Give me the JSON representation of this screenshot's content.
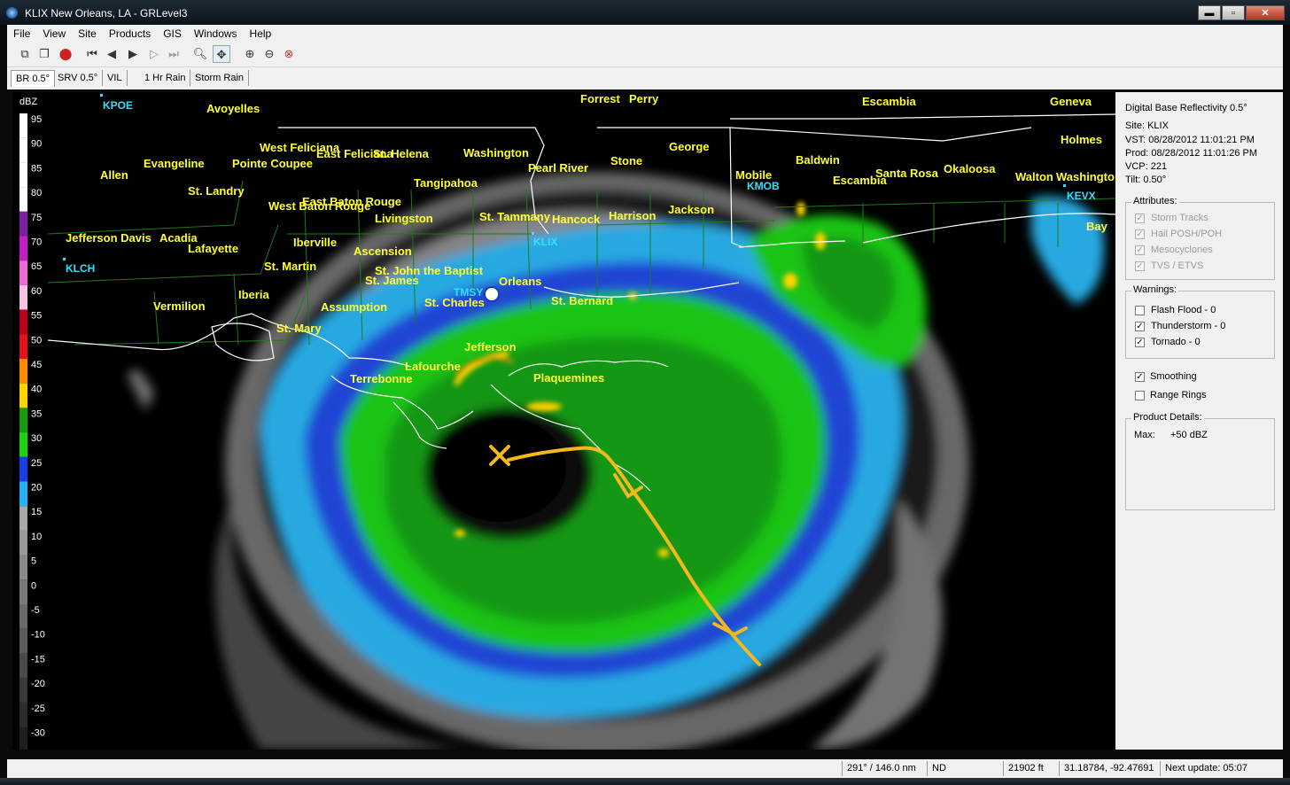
{
  "window": {
    "title": "KLIX New Orleans, LA - GRLevel3",
    "minimize_glyph": "▬",
    "maximize_glyph": "▫",
    "close_glyph": "✕"
  },
  "menu": [
    "File",
    "View",
    "Site",
    "Products",
    "GIS",
    "Windows",
    "Help"
  ],
  "toolbar_icons": [
    "copy-icon",
    "paste-icon",
    "record-icon",
    "first-frame-icon",
    "prev-frame-icon",
    "play-icon",
    "next-frame-icon",
    "last-frame-icon",
    "zoom-icon",
    "pan-icon",
    "zoom-in-icon",
    "zoom-out-icon",
    "zoom-reset-icon"
  ],
  "tabs": [
    "BR 0.5°",
    "SRV 0.5°",
    "VIL",
    "1 Hr Rain",
    "Storm Rain"
  ],
  "color_scale": {
    "unit": "dBZ",
    "ticks": [
      "95",
      "90",
      "85",
      "80",
      "75",
      "70",
      "65",
      "60",
      "55",
      "50",
      "45",
      "40",
      "35",
      "30",
      "25",
      "20",
      "15",
      "10",
      "5",
      "0",
      "-5",
      "-10",
      "-15",
      "-20",
      "-25",
      "-30"
    ],
    "colors": [
      "#ffffff",
      "#ffffff",
      "#ffffff",
      "#ffffff",
      "#7c1fa3",
      "#c21fc4",
      "#ef6ad5",
      "#f5c3e3",
      "#b8001b",
      "#e0141a",
      "#ff8c00",
      "#ffd200",
      "#159a12",
      "#1fd013",
      "#1a3ee8",
      "#26b0f5",
      "#a8a8a8",
      "#9a9a9a",
      "#8a8a8a",
      "#7a7a7a",
      "#6a6a6a",
      "#5a5a5a",
      "#4a4a4a",
      "#3a3a3a",
      "#2c2c2c",
      "#1e1e1e"
    ]
  },
  "stations": [
    "KPOE",
    "KLCH",
    "KLIX",
    "KMOB",
    "KEVX",
    "TMSY"
  ],
  "places": [
    "Avoyelles",
    "Forrest",
    "Perry",
    "Escambia",
    "Geneva",
    "West Feliciana",
    "East Feliciana",
    "St. Helena",
    "Washington",
    "George",
    "Holmes",
    "Evangeline",
    "Pointe Coupee",
    "Pearl River",
    "Stone",
    "Baldwin",
    "Allen",
    "St. Landry",
    "Tangipahoa",
    "Mobile",
    "Escambia",
    "Santa Rosa",
    "Okaloosa",
    "Walton",
    "Washington",
    "East Baton Rouge",
    "West Baton Rouge",
    "Livingston",
    "St. Tammany",
    "Hancock",
    "Harrison",
    "Jackson",
    "Jefferson Davis",
    "Acadia",
    "Lafayette",
    "Iberville",
    "Bay",
    "Ascension",
    "St. Martin",
    "St. John the Baptist",
    "St. James",
    "Orleans",
    "Iberia",
    "St. Charles",
    "St. Bernard",
    "Vermilion",
    "Assumption",
    "St. Mary",
    "Jefferson",
    "Lafourche",
    "Terrebonne",
    "Plaquemines"
  ],
  "product": {
    "name": "Digital Base Reflectivity 0.5°",
    "site": "Site:  KLIX",
    "vst": "VST:  08/28/2012  11:01:21 PM",
    "prod": "Prod: 08/28/2012  11:01:26 PM",
    "vcp": "VCP:  221",
    "tilt": "Tilt:  0.50°"
  },
  "attributes": {
    "legend": "Attributes:",
    "items": [
      {
        "label": "Storm Tracks",
        "checked": true
      },
      {
        "label": "Hail POSH/POH",
        "checked": true
      },
      {
        "label": "Mesocyclones",
        "checked": true
      },
      {
        "label": "TVS / ETVS",
        "checked": true
      }
    ]
  },
  "warnings": {
    "legend": "Warnings:",
    "items": [
      {
        "label": "Flash Flood - 0",
        "checked": false
      },
      {
        "label": "Thunderstorm - 0",
        "checked": true
      },
      {
        "label": "Tornado - 0",
        "checked": true
      }
    ]
  },
  "options": [
    {
      "label": "Smoothing",
      "checked": true
    },
    {
      "label": "Range Rings",
      "checked": false
    }
  ],
  "product_details": {
    "legend": "Product Details:",
    "max_label": "Max:",
    "max_value": "+50 dBZ"
  },
  "status": {
    "cursor": "291° / 146.0 nm",
    "value": "ND",
    "height": "21902 ft",
    "coords": "31.18784, -92.47691",
    "next_update": "Next update: 05:07"
  },
  "colors": {
    "label_yellow": "#ffff33",
    "station_cyan": "#33e0ff",
    "annotation_orange": "#f2b81c"
  }
}
